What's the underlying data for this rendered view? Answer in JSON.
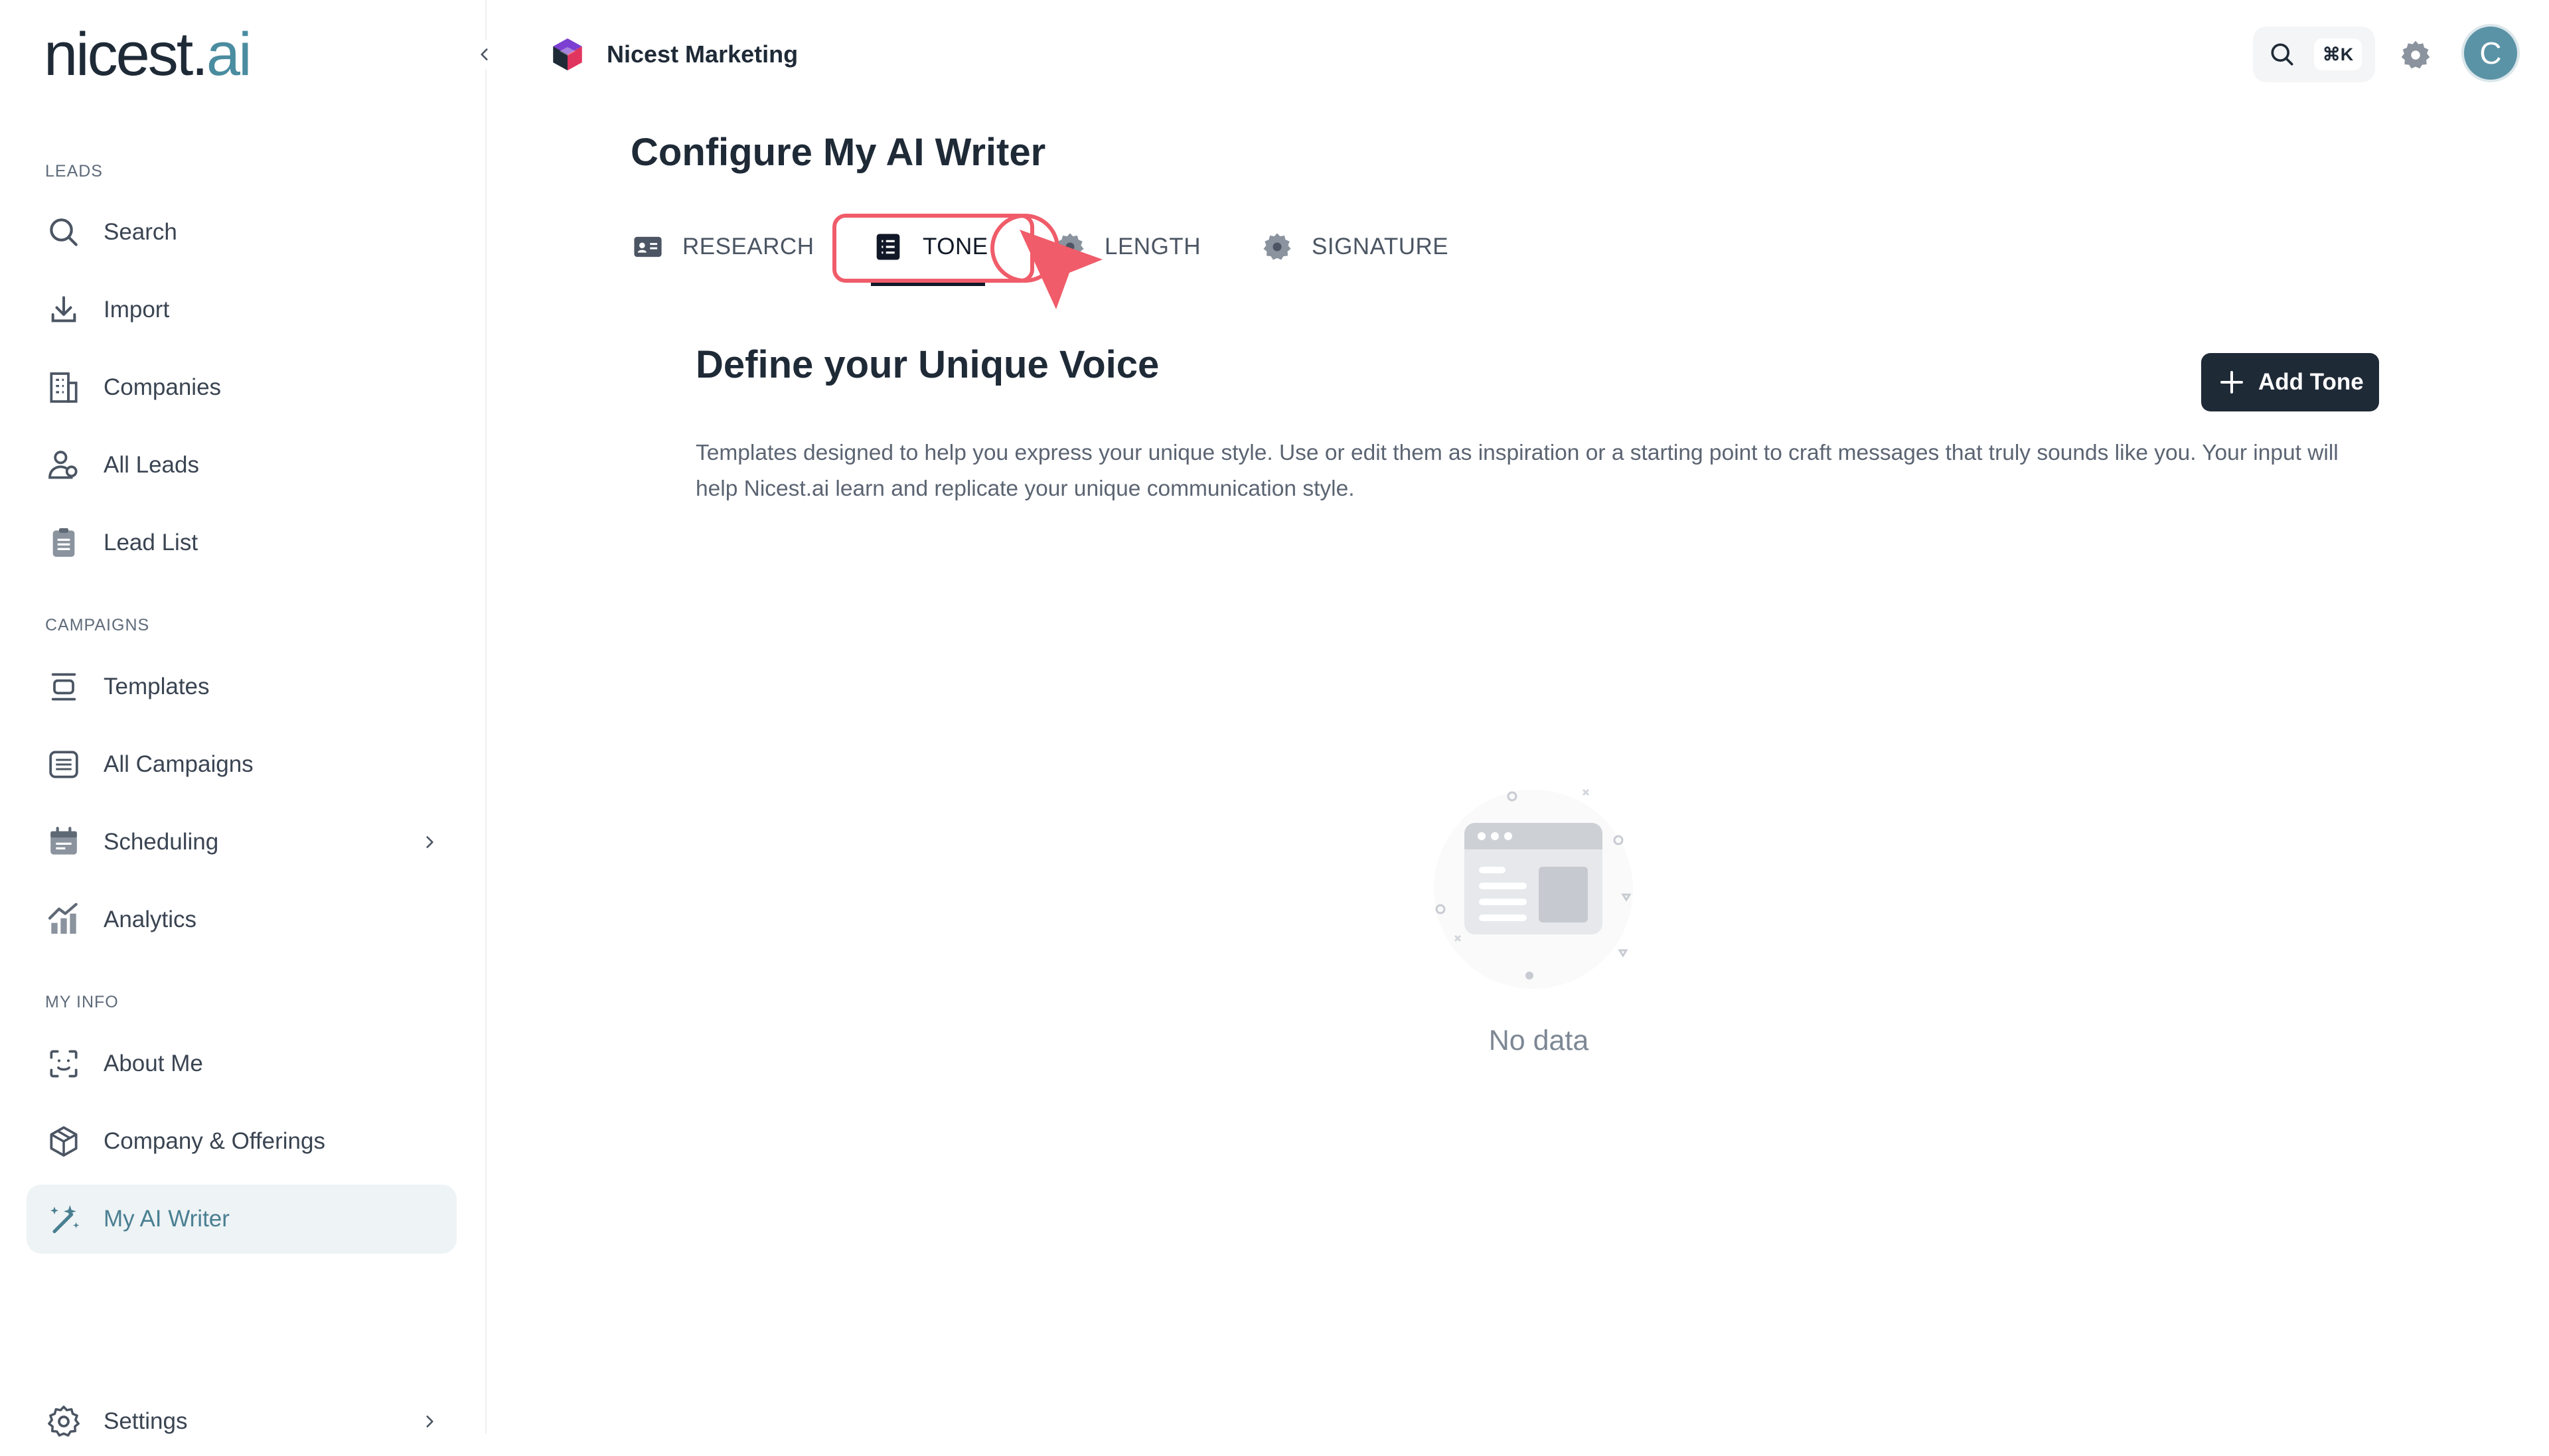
{
  "sidebar": {
    "logo_main": "nicest.",
    "logo_accent": "ai",
    "sections": {
      "leads": "LEADS",
      "campaigns": "CAMPAIGNS",
      "my_info": "MY INFO"
    },
    "items": {
      "search": "Search",
      "import": "Import",
      "companies": "Companies",
      "all_leads": "All Leads",
      "lead_list": "Lead List",
      "templates": "Templates",
      "all_campaigns": "All Campaigns",
      "scheduling": "Scheduling",
      "analytics": "Analytics",
      "about_me": "About Me",
      "company_offerings": "Company & Offerings",
      "my_ai_writer": "My AI Writer",
      "settings": "Settings"
    },
    "active_item": "My AI Writer"
  },
  "header": {
    "workspace_name": "Nicest Marketing",
    "shortcut": "⌘K",
    "avatar_initial": "C"
  },
  "main": {
    "title": "Configure My AI Writer",
    "tabs": {
      "research": "RESEARCH",
      "tone": "TONE",
      "length": "LENGTH",
      "signature": "SIGNATURE"
    },
    "active_tab": "TONE",
    "section_title": "Define your Unique Voice",
    "add_button": "Add Tone",
    "description": "Templates designed to help you express your unique style. Use or edit them as inspiration or a starting point to craft messages that truly sounds like you. Your input will help Nicest.ai learn and replicate your unique communication style.",
    "empty_text": "No data"
  },
  "colors": {
    "accent": "#4a8ca0",
    "dark_button": "#1f2a37",
    "highlight": "#f05c6a",
    "active_nav_bg": "#eef3f5"
  }
}
